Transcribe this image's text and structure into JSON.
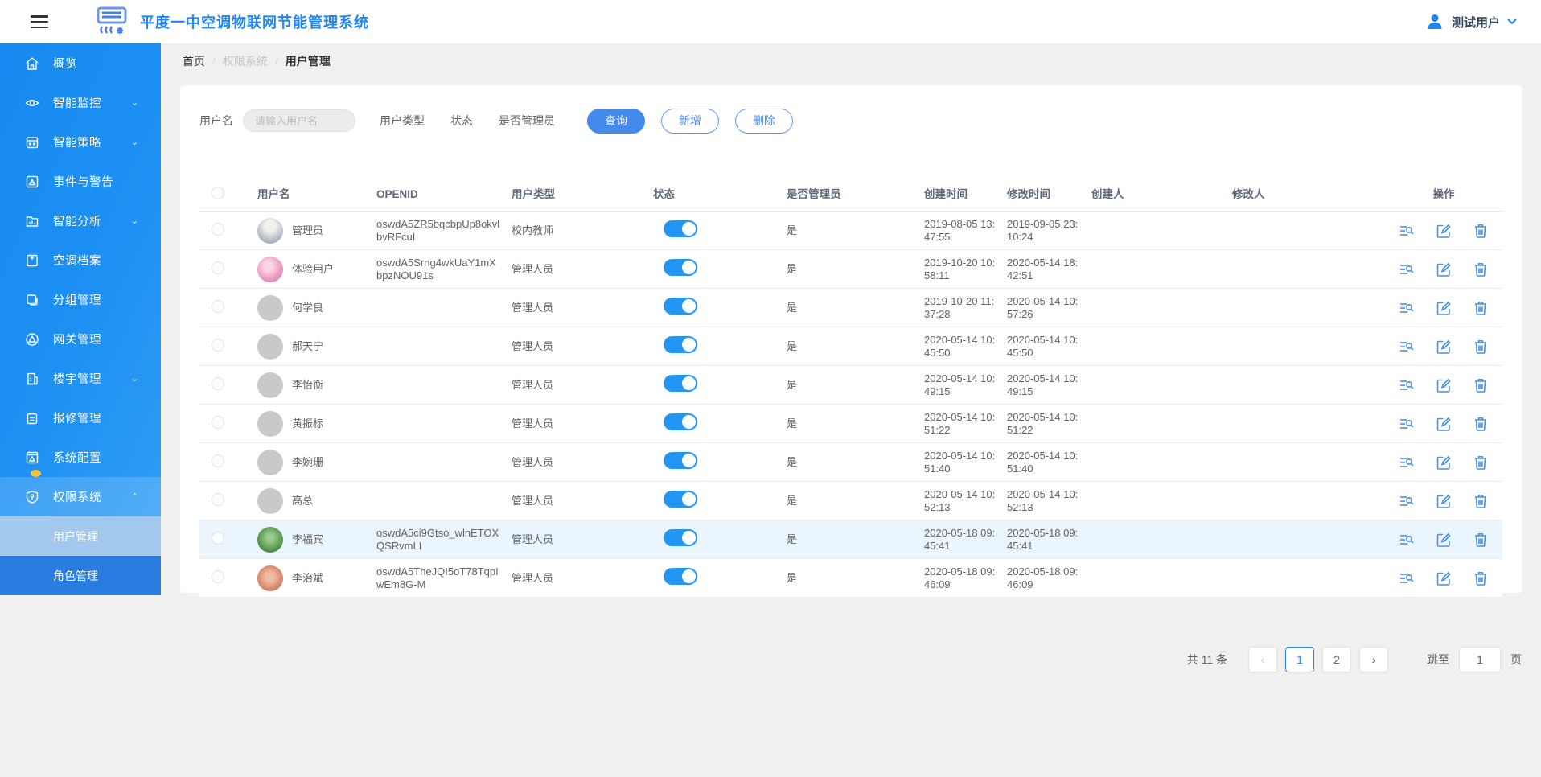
{
  "header": {
    "title": "平度一中空调物联网节能管理系统",
    "user": {
      "name": "测试用户"
    }
  },
  "sidebar": {
    "items": [
      {
        "label": "概览",
        "icon": "home-icon"
      },
      {
        "label": "智能监控",
        "icon": "eye-icon",
        "expandable": true
      },
      {
        "label": "智能策略",
        "icon": "strategy-icon",
        "expandable": true
      },
      {
        "label": "事件与警告",
        "icon": "alert-icon"
      },
      {
        "label": "智能分析",
        "icon": "analysis-icon",
        "expandable": true
      },
      {
        "label": "空调档案",
        "icon": "archive-icon"
      },
      {
        "label": "分组管理",
        "icon": "group-icon"
      },
      {
        "label": "网关管理",
        "icon": "gateway-icon"
      },
      {
        "label": "楼宇管理",
        "icon": "building-icon",
        "expandable": true
      },
      {
        "label": "报修管理",
        "icon": "repair-icon"
      },
      {
        "label": "系统配置",
        "icon": "config-icon",
        "badge": true
      },
      {
        "label": "权限系统",
        "icon": "shield-key-icon",
        "expandable": true,
        "expanded": true,
        "children": [
          {
            "label": "用户管理",
            "active": true
          },
          {
            "label": "角色管理",
            "active": false
          }
        ]
      }
    ]
  },
  "breadcrumb": {
    "home": "首页",
    "mid": "权限系统",
    "current": "用户管理"
  },
  "filters": {
    "username_label": "用户名",
    "username_placeholder": "请输入用户名",
    "usertype_label": "用户类型",
    "status_label": "状态",
    "admin_label": "是否管理员",
    "query_button": "查询",
    "add_button": "新增",
    "delete_button": "删除"
  },
  "table": {
    "headers": {
      "name": "用户名",
      "openid": "OPENID",
      "type": "用户类型",
      "status": "状态",
      "admin": "是否管理员",
      "created": "创建时间",
      "modified": "修改时间",
      "creator": "创建人",
      "modifier": "修改人",
      "ops": "操作"
    },
    "rows": [
      {
        "name": "管理员",
        "openid": "oswdA5ZR5bqcbpUp8okvlbvRFcuI",
        "type": "校内教师",
        "status": "on",
        "admin": "是",
        "created": "2019-08-05 13:47:55",
        "modified": "2019-09-05 23:10:24",
        "creator": "",
        "modifier": "",
        "avatar": "photo-admin",
        "highlighted": false
      },
      {
        "name": "体验用户",
        "openid": "oswdA5Srng4wkUaY1mXbpzNOU91s",
        "type": "管理人员",
        "status": "on",
        "admin": "是",
        "created": "2019-10-20 10:58:11",
        "modified": "2020-05-14 18:42:51",
        "creator": "",
        "modifier": "",
        "avatar": "photo-pink",
        "highlighted": false
      },
      {
        "name": "何学良",
        "openid": "",
        "type": "管理人员",
        "status": "on",
        "admin": "是",
        "created": "2019-10-20 11:37:28",
        "modified": "2020-05-14 10:57:26",
        "creator": "",
        "modifier": "",
        "avatar": "gray",
        "highlighted": false
      },
      {
        "name": "郝天宁",
        "openid": "",
        "type": "管理人员",
        "status": "on",
        "admin": "是",
        "created": "2020-05-14 10:45:50",
        "modified": "2020-05-14 10:45:50",
        "creator": "",
        "modifier": "",
        "avatar": "gray",
        "highlighted": false
      },
      {
        "name": "李怡衡",
        "openid": "",
        "type": "管理人员",
        "status": "on",
        "admin": "是",
        "created": "2020-05-14 10:49:15",
        "modified": "2020-05-14 10:49:15",
        "creator": "",
        "modifier": "",
        "avatar": "gray",
        "highlighted": false
      },
      {
        "name": "黄振标",
        "openid": "",
        "type": "管理人员",
        "status": "on",
        "admin": "是",
        "created": "2020-05-14 10:51:22",
        "modified": "2020-05-14 10:51:22",
        "creator": "",
        "modifier": "",
        "avatar": "gray",
        "highlighted": false
      },
      {
        "name": "李婉珊",
        "openid": "",
        "type": "管理人员",
        "status": "on",
        "admin": "是",
        "created": "2020-05-14 10:51:40",
        "modified": "2020-05-14 10:51:40",
        "creator": "",
        "modifier": "",
        "avatar": "gray",
        "highlighted": false
      },
      {
        "name": "高总",
        "openid": "",
        "type": "管理人员",
        "status": "on",
        "admin": "是",
        "created": "2020-05-14 10:52:13",
        "modified": "2020-05-14 10:52:13",
        "creator": "",
        "modifier": "",
        "avatar": "gray",
        "highlighted": false
      },
      {
        "name": "李福宾",
        "openid": "oswdA5ci9Gtso_wlnETOXQSRvmLI",
        "type": "管理人员",
        "status": "on",
        "admin": "是",
        "created": "2020-05-18 09:45:41",
        "modified": "2020-05-18 09:45:41",
        "creator": "",
        "modifier": "",
        "avatar": "photo-green",
        "highlighted": true
      },
      {
        "name": "李治斌",
        "openid": "oswdA5TheJQI5oT78TqpIwEm8G-M",
        "type": "管理人员",
        "status": "on",
        "admin": "是",
        "created": "2020-05-18 09:46:09",
        "modified": "2020-05-18 09:46:09",
        "creator": "",
        "modifier": "",
        "avatar": "photo-skin",
        "highlighted": false
      }
    ]
  },
  "pagination": {
    "total": "共 11 条",
    "pages": [
      "1",
      "2"
    ],
    "current": "1",
    "jump_label": "跳至",
    "jump_value": "1",
    "page_suffix": "页"
  },
  "colors": {
    "primary_blue": "#2186f0",
    "sidebar_blue": "#1e91f3",
    "submenu_active": "#a3c8ee",
    "submenu_normal": "#2b7ce0",
    "toggle_on": "#2196f3",
    "badge_yellow": "#f3c243",
    "row_highlight": "#eaf5fd"
  }
}
